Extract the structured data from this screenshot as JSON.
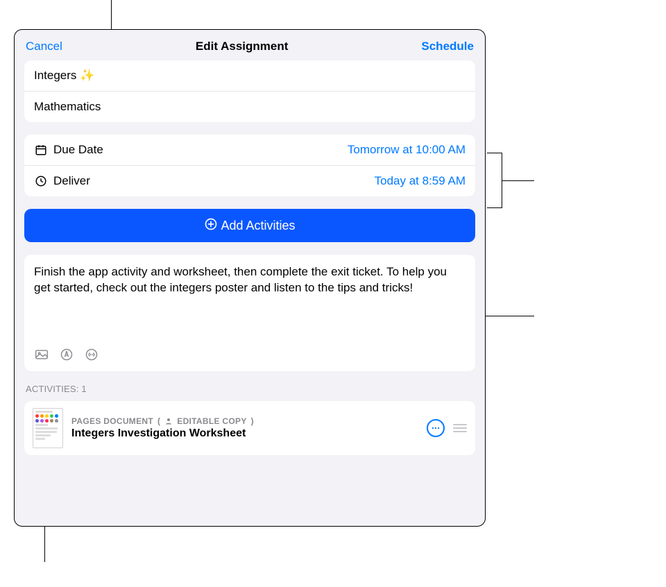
{
  "header": {
    "cancel_label": "Cancel",
    "title": "Edit Assignment",
    "schedule_label": "Schedule"
  },
  "assignment": {
    "title_value": "Integers ✨",
    "class_value": "Mathematics"
  },
  "schedule": {
    "due_label": "Due Date",
    "due_value": "Tomorrow at 10:00 AM",
    "deliver_label": "Deliver",
    "deliver_value": "Today at 8:59 AM"
  },
  "add_activities_label": "Add Activities",
  "instructions": "Finish the app activity and worksheet, then complete the exit ticket. To help you get started, check out the integers poster and listen to the tips and tricks!",
  "activities": {
    "section_label": "ACTIVITIES: 1",
    "items": [
      {
        "type_label": "PAGES DOCUMENT",
        "badge_label": "EDITABLE COPY",
        "title": "Integers Investigation Worksheet"
      }
    ]
  }
}
